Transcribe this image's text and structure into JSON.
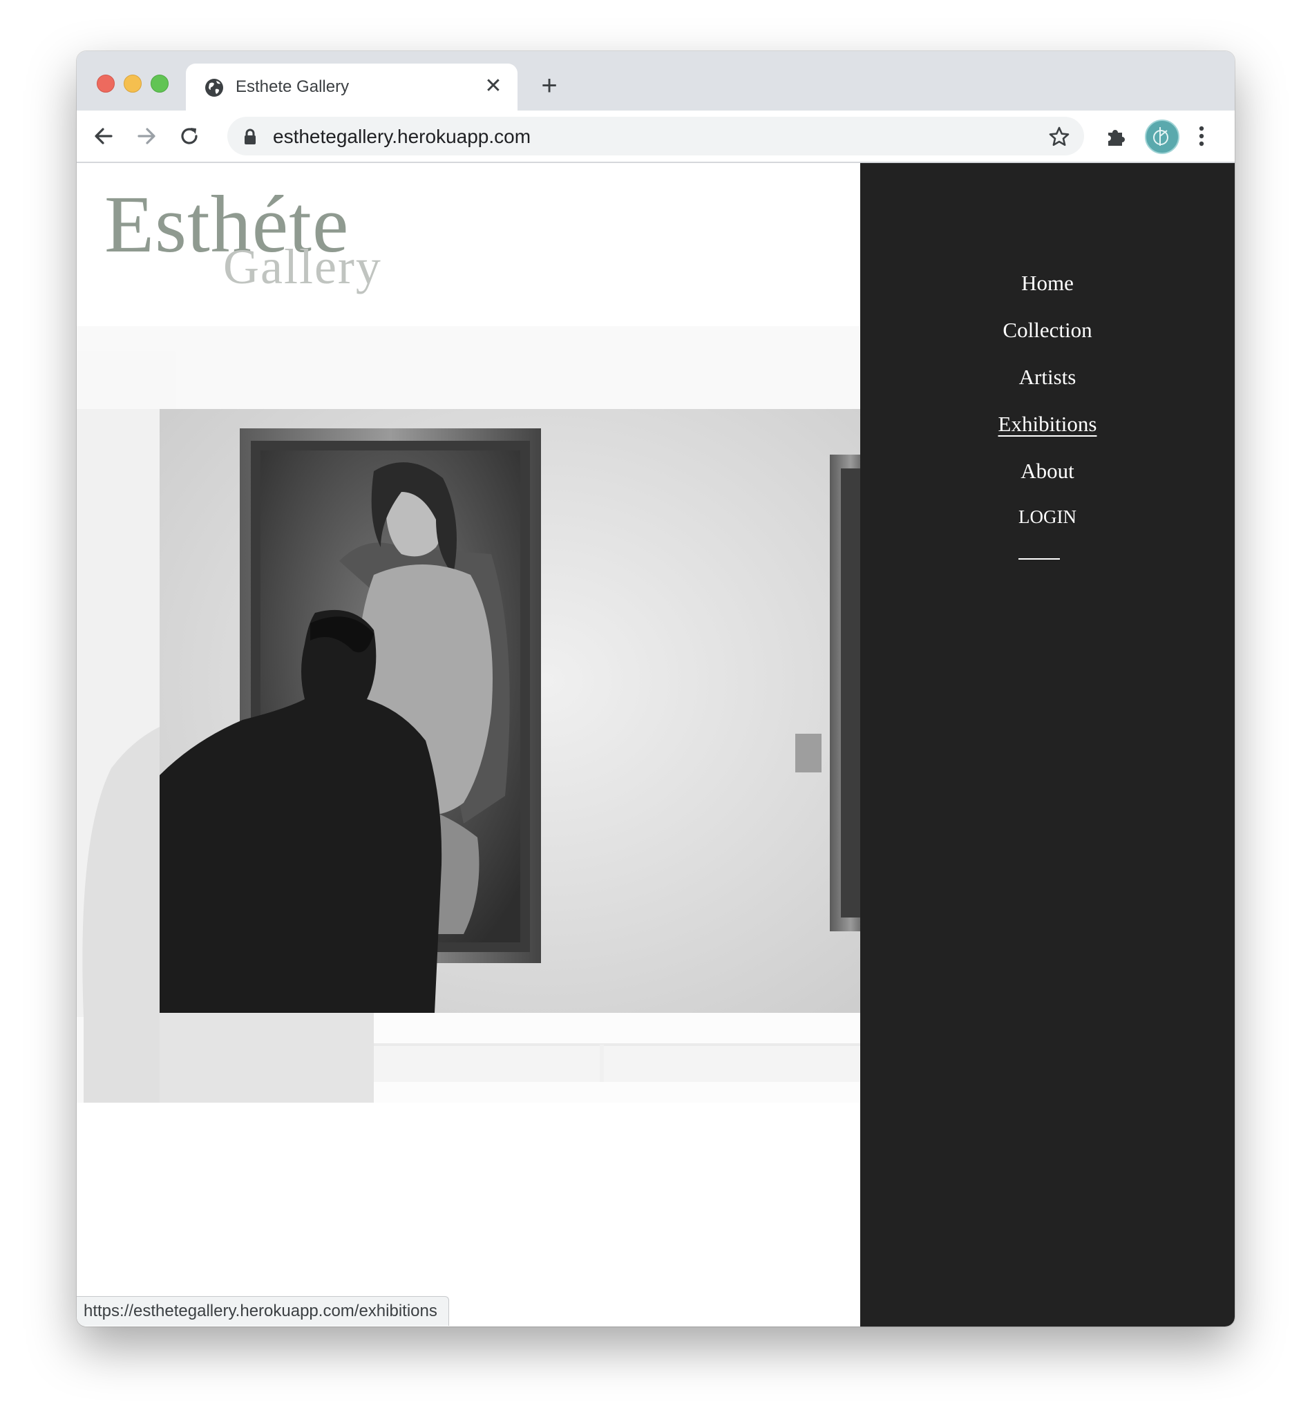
{
  "browser": {
    "tab_title": "Esthete Gallery",
    "new_tab_label": "+",
    "close_tab_label": "✕",
    "url": "esthetegallery.herokuapp.com",
    "status_url": "https://esthetegallery.herokuapp.com/exhibitions"
  },
  "site": {
    "logo_line1": "Esthéte",
    "logo_line2": "Gallery",
    "nav": [
      {
        "label": "Home",
        "active": false
      },
      {
        "label": "Collection",
        "active": false
      },
      {
        "label": "Artists",
        "active": false
      },
      {
        "label": "Exhibitions",
        "active": true
      },
      {
        "label": "About",
        "active": false
      },
      {
        "label": "LOGIN",
        "active": false
      }
    ]
  },
  "icons": {
    "favicon": "globe-icon",
    "back": "arrow-left-icon",
    "forward": "arrow-right-icon",
    "reload": "reload-icon",
    "lock": "lock-icon",
    "bookmark": "star-icon",
    "extensions": "puzzle-icon",
    "profile": "avatar",
    "menu": "kebab-icon"
  },
  "colors": {
    "sidebar_bg": "#222222",
    "logo_primary": "#8f9a90",
    "logo_secondary": "#c0c4c0",
    "tabstrip_bg": "#dee1e6",
    "profile_accent": "#5aa9ad"
  }
}
